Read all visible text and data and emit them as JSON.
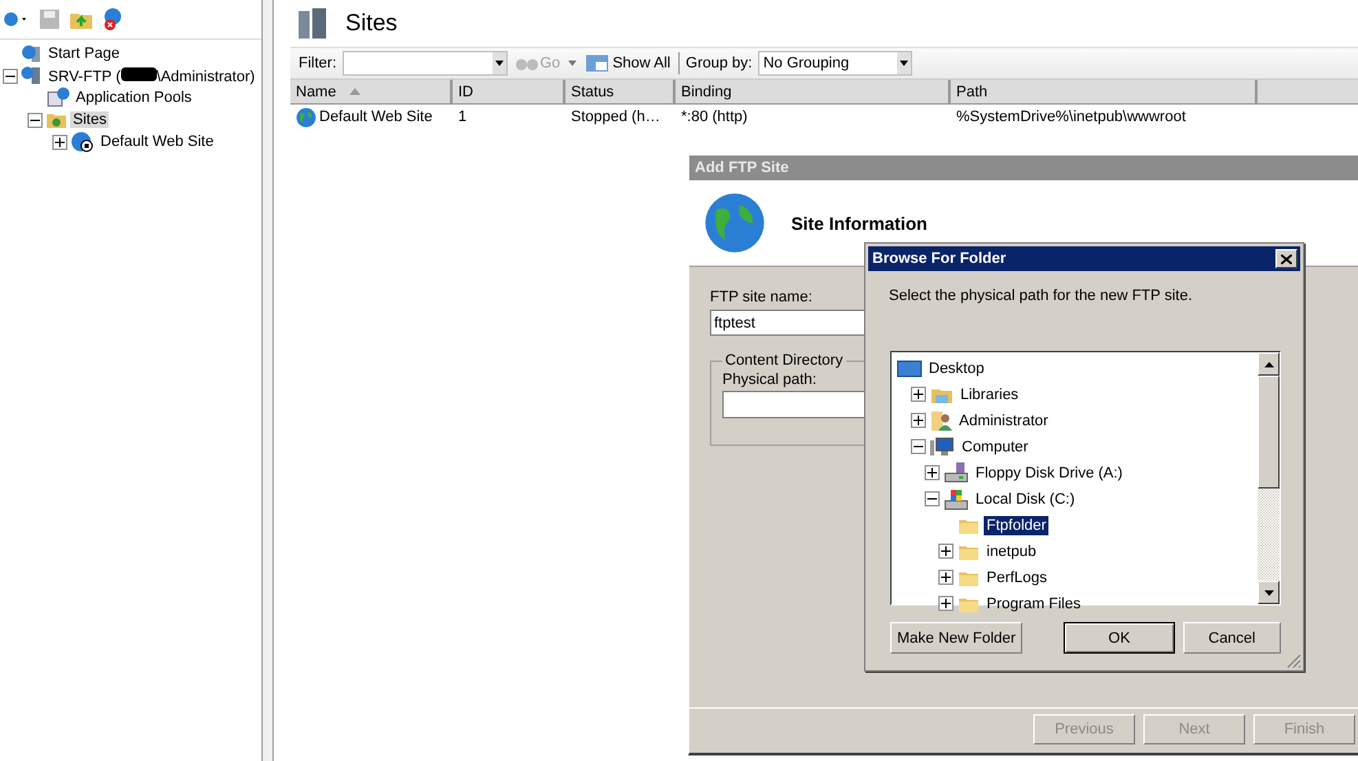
{
  "nav_tree": [
    {
      "label": "Start Page",
      "kind": "start",
      "selected": false
    },
    {
      "label": "SRV-FTP (",
      "label_after_redaction": "\\Administrator)",
      "kind": "server",
      "expanded": true,
      "selected": false,
      "children": [
        {
          "label": "Application Pools",
          "kind": "pools",
          "selected": false
        },
        {
          "label": "Sites",
          "kind": "sites",
          "expanded": true,
          "selected": true,
          "children": [
            {
              "label": "Default Web Site",
              "kind": "site",
              "expanded": false,
              "selected": false
            }
          ]
        }
      ]
    }
  ],
  "content": {
    "title": "Sites",
    "filter": {
      "label": "Filter:"
    },
    "go": {
      "label": "Go",
      "disabled": true
    },
    "show_all": {
      "label": "Show All"
    },
    "group_by": {
      "label": "Group by:",
      "value": "No Grouping"
    },
    "table": {
      "columns": [
        {
          "label": "Name",
          "sorted": true
        },
        {
          "label": "ID",
          "sorted": false
        },
        {
          "label": "Status",
          "sorted": false
        },
        {
          "label": "Binding",
          "sorted": false
        },
        {
          "label": "Path",
          "sorted": false
        }
      ],
      "rows": [
        {
          "cells": [
            "Default Web Site",
            "1",
            "Stopped (h…",
            "*:80 (http)",
            "%SystemDrive%\\inetpub\\wwwroot"
          ]
        }
      ]
    }
  },
  "add_ftp_site": {
    "title": "Add FTP Site",
    "header": "Site Information",
    "site_name": {
      "label": "FTP site name:",
      "value": "ftptest"
    },
    "content_directory": {
      "legend": "Content Directory",
      "physical_path_label": "Physical path:"
    },
    "buttons": [
      {
        "label": "Previous",
        "disabled": true
      },
      {
        "label": "Next",
        "disabled": true
      },
      {
        "label": "Finish",
        "disabled": true
      }
    ]
  },
  "browse_for_folder": {
    "title": "Browse For Folder",
    "instruction": "Select the physical path for the new FTP site.",
    "tree": [
      {
        "label": "Desktop",
        "kind": "desktop",
        "selected": false,
        "children": [
          {
            "label": "Libraries",
            "kind": "libraries",
            "expanded": false,
            "selected": false
          },
          {
            "label": "Administrator",
            "kind": "user",
            "expanded": false,
            "selected": false
          },
          {
            "label": "Computer",
            "kind": "computer",
            "expanded": true,
            "selected": false,
            "children": [
              {
                "label": "Floppy Disk Drive (A:)",
                "kind": "floppy",
                "expanded": false,
                "selected": false
              },
              {
                "label": "Local Disk (C:)",
                "kind": "disk",
                "expanded": true,
                "selected": false,
                "children": [
                  {
                    "label": "Ftpfolder",
                    "kind": "folder",
                    "selected": true
                  },
                  {
                    "label": "inetpub",
                    "kind": "folder",
                    "expanded": false,
                    "selected": false
                  },
                  {
                    "label": "PerfLogs",
                    "kind": "folder",
                    "expanded": false,
                    "selected": false
                  },
                  {
                    "label": "Program Files",
                    "kind": "folder",
                    "expanded": false,
                    "selected": false
                  }
                ]
              }
            ]
          }
        ]
      }
    ],
    "buttons": [
      {
        "label": "Make New Folder",
        "default": false
      },
      {
        "label": "OK",
        "default": true
      },
      {
        "label": "Cancel",
        "default": false
      }
    ]
  }
}
